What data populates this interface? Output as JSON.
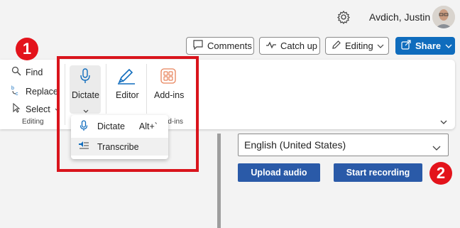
{
  "user": {
    "name": "Avdich, Justin"
  },
  "toolbar": {
    "comments": "Comments",
    "catchup": "Catch up",
    "editing": "Editing",
    "share": "Share"
  },
  "ribbon": {
    "find": "Find",
    "replace": "Replace",
    "select": "Select",
    "editing_group": "Editing",
    "dictate": "Dictate",
    "editor": "Editor",
    "addins": "Add-ins",
    "addins_group": "Add-ins"
  },
  "dictate_menu": {
    "items": [
      {
        "label": "Dictate",
        "shortcut": "Alt+`"
      },
      {
        "label": "Transcribe"
      }
    ]
  },
  "transcribe_pane": {
    "language": "English (United States)",
    "upload": "Upload audio",
    "record": "Start recording"
  },
  "annotations": {
    "step1": "1",
    "step2": "2"
  },
  "colors": {
    "accent": "#0f6cbd",
    "highlight": "#d9141c",
    "button": "#2a5aa8"
  }
}
